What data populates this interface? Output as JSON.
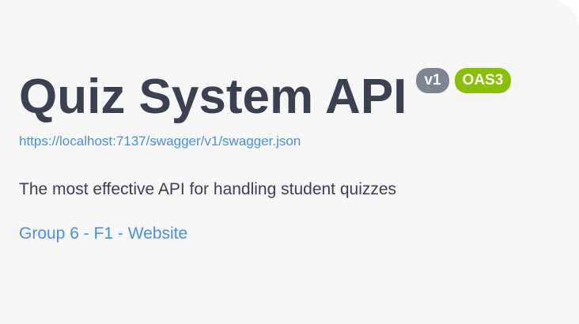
{
  "info": {
    "title": "Quiz System API",
    "version_badge": "v1",
    "oas_badge": "OAS3",
    "spec_url": "https://localhost:7137/swagger/v1/swagger.json",
    "description": "The most effective API for handling student quizzes",
    "contact_link": "Group 6 - F1 - Website"
  },
  "colors": {
    "title": "#3b4151",
    "link": "#4990e2",
    "version_badge_bg": "#7d8492",
    "oas_badge_bg": "#89bf04",
    "panel_bg": "#f7f7f8"
  }
}
